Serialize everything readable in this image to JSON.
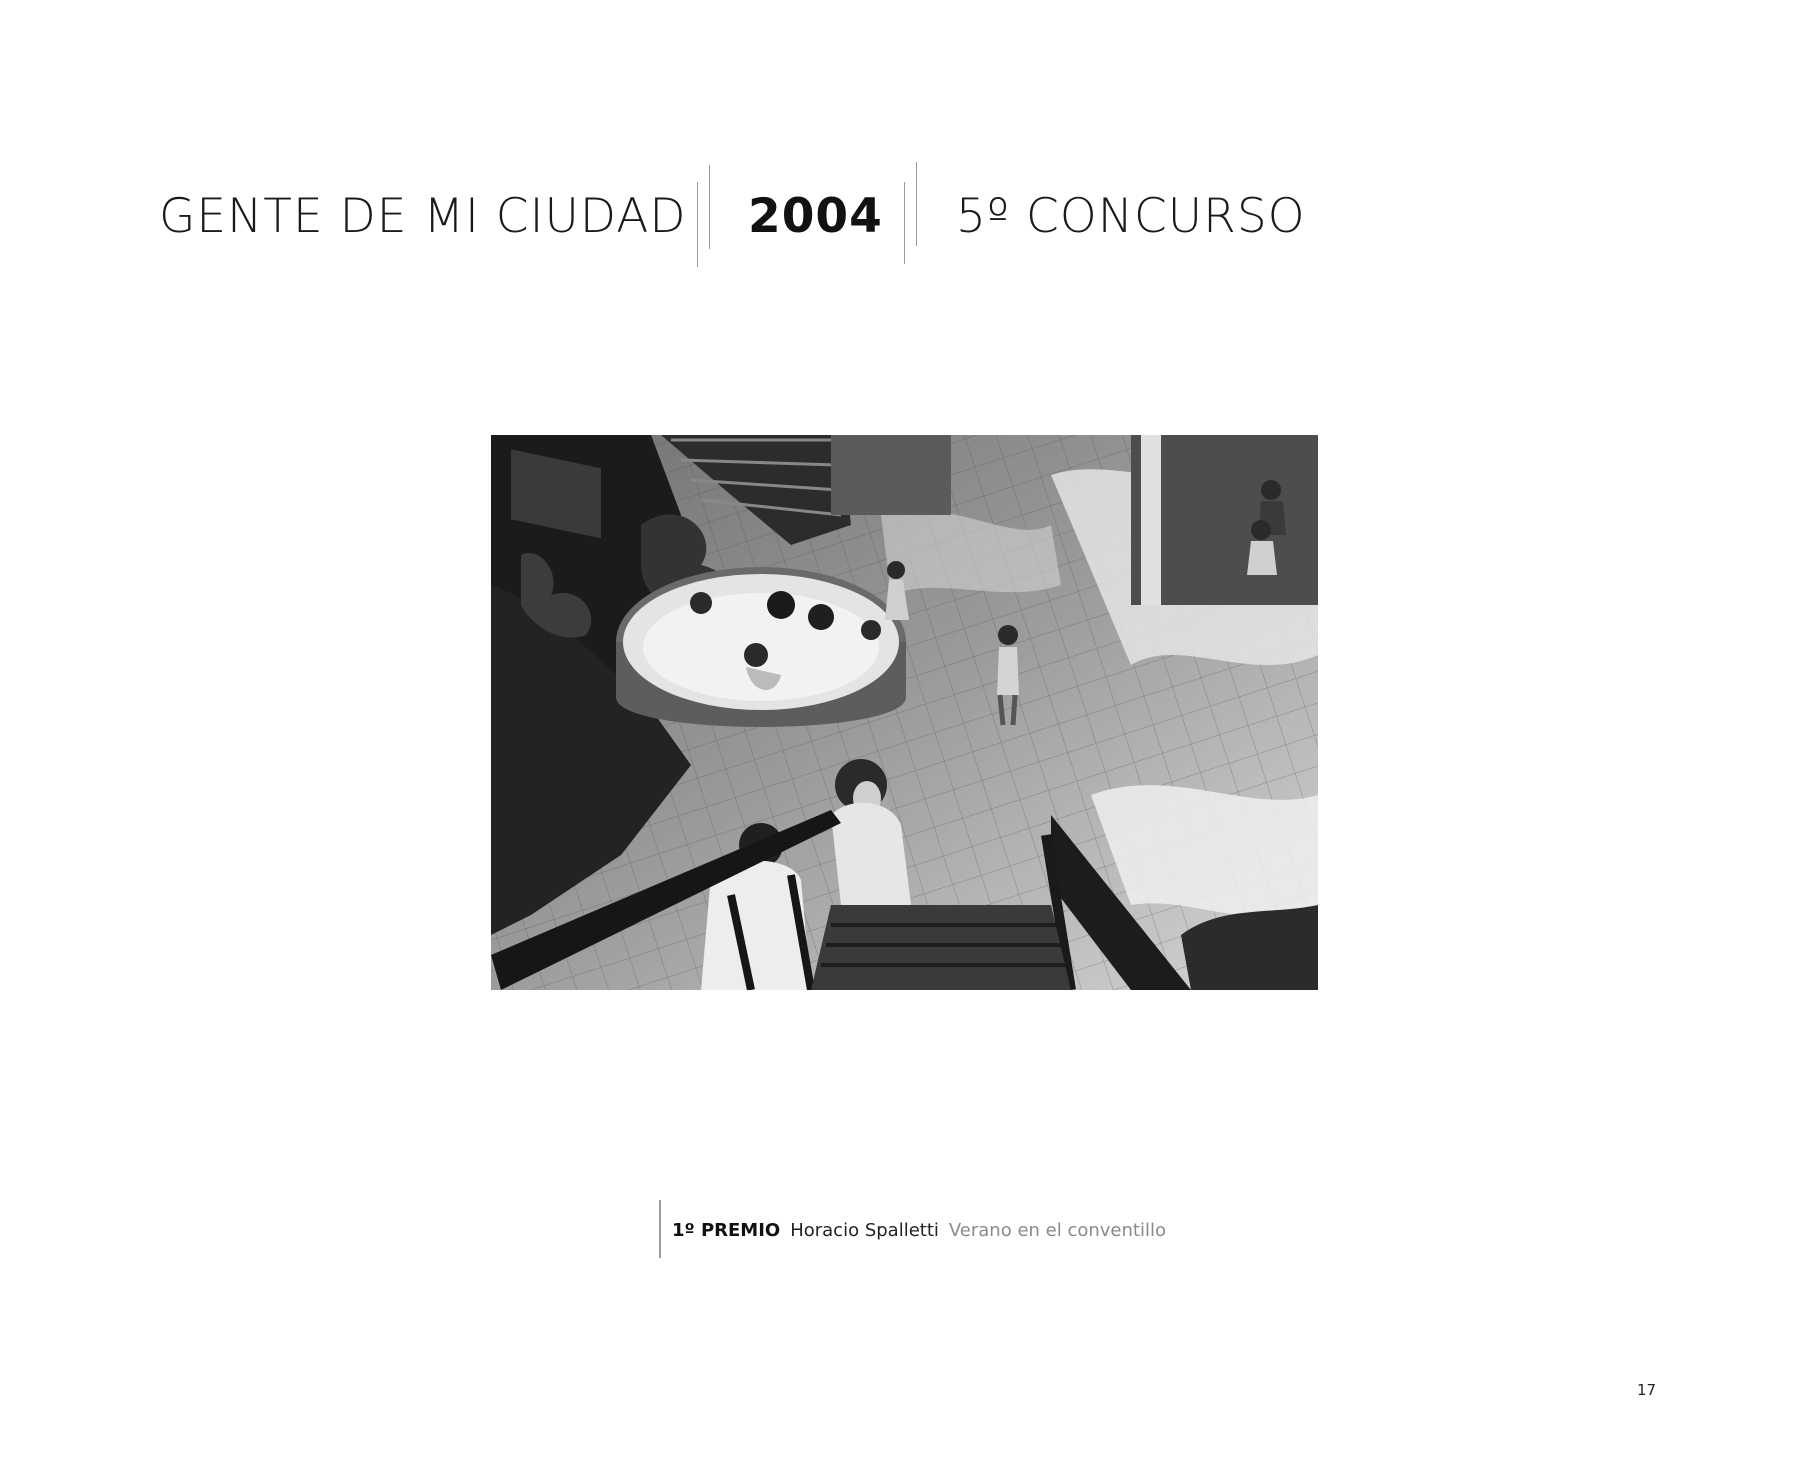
{
  "header": {
    "series_title": "GENTE DE MI CIUDAD",
    "year": "2004",
    "contest": "5º CONCURSO"
  },
  "photo": {
    "color_mode": "black-and-white"
  },
  "caption": {
    "prize": "1º PREMIO",
    "author": "Horacio Spalletti",
    "work_title": "Verano en el conventillo"
  },
  "footer": {
    "page_number": "17"
  },
  "colors": {
    "text": "#1a1a1a",
    "separator": "#9a9a9a",
    "work_title": "#8a8a8a",
    "background": "#ffffff"
  }
}
